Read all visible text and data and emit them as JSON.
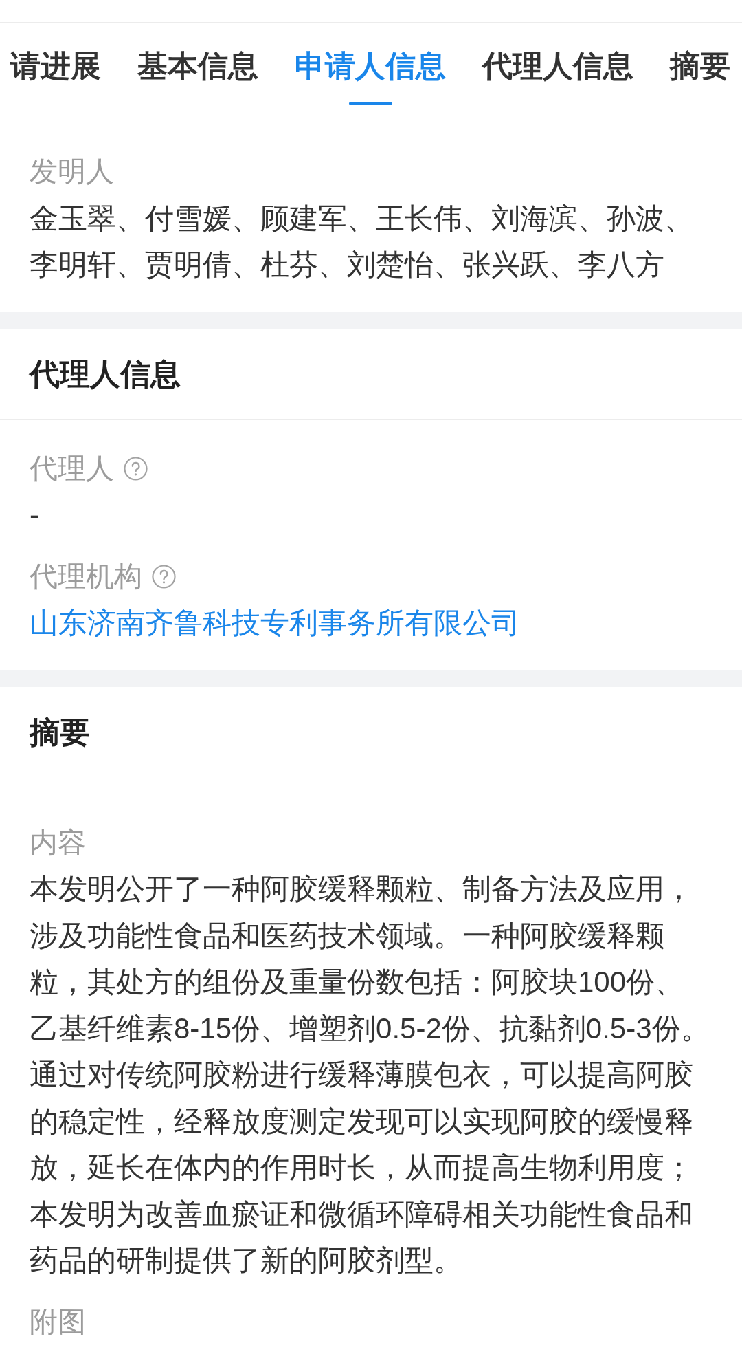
{
  "tabs": [
    {
      "label": "请进展",
      "selected": false
    },
    {
      "label": "基本信息",
      "selected": false
    },
    {
      "label": "申请人信息",
      "selected": true
    },
    {
      "label": "代理人信息",
      "selected": false
    },
    {
      "label": "摘要",
      "selected": false
    }
  ],
  "sections": [
    {
      "fields": [
        {
          "label": "发明人",
          "help": false,
          "kind": "text",
          "value": "金玉翠、付雪媛、顾建军、王长伟、刘海滨、孙波、李明轩、贾明倩、杜芬、刘楚怡、张兴跃、李八方"
        }
      ]
    },
    {
      "title": "代理人信息",
      "fields": [
        {
          "label": "代理人",
          "help": true,
          "kind": "text",
          "value": "-"
        },
        {
          "label": "代理机构",
          "help": true,
          "kind": "link",
          "value": "山东济南齐鲁科技专利事务所有限公司"
        }
      ]
    },
    {
      "title": "摘要",
      "fields": [
        {
          "label": "内容",
          "help": false,
          "kind": "text",
          "value": "本发明公开了一种阿胶缓释颗粒、制备方法及应用，涉及功能性食品和医药技术领域。一种阿胶缓释颗粒，其处方的组份及重量份数包括：阿胶块100份、乙基纤维素8-15份、增塑剂0.5-2份、抗黏剂0.5-3份。通过对传统阿胶粉进行缓释薄膜包衣，可以提高阿胶的稳定性，经释放度测定发现可以实现阿胶的缓慢释放，延长在体内的作用时长，从而提高生物利用度；本发明为改善血瘀证和微循环障碍相关功能性食品和药品的研制提供了新的阿胶剂型。"
        },
        {
          "label": "附图",
          "help": false
        }
      ]
    }
  ]
}
